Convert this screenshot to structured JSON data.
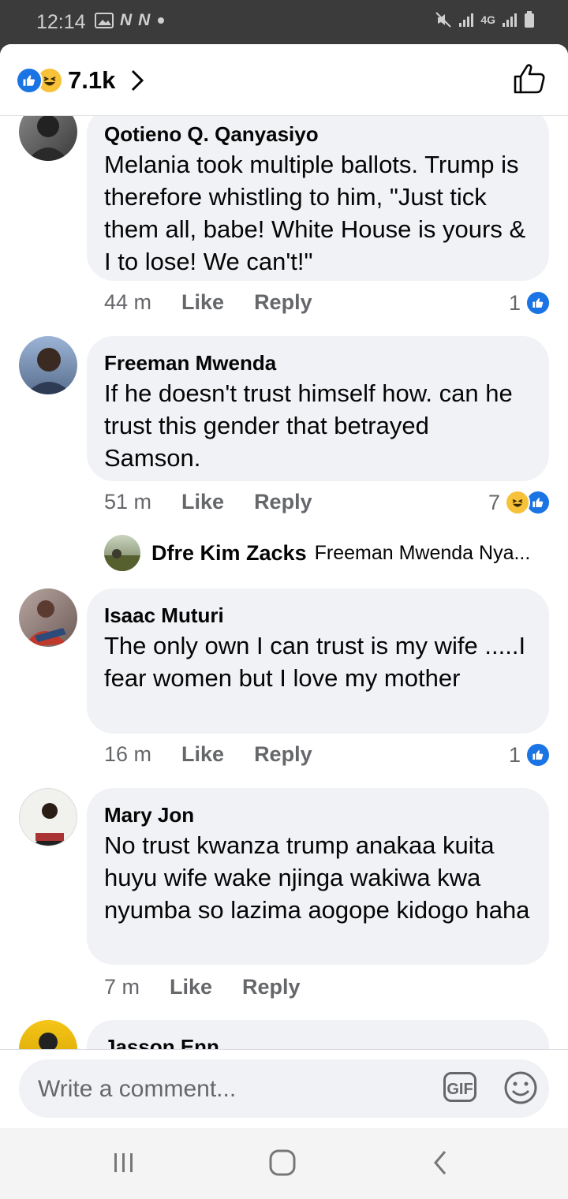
{
  "status_bar": {
    "time": "12:14",
    "icons": [
      "gallery-icon",
      "nn-icon",
      "nn-icon",
      "dot-icon",
      "mute-icon",
      "signal-icon",
      "4g-icon",
      "signal-icon",
      "battery-icon"
    ],
    "nn_label": "N",
    "lte_label": "4G"
  },
  "header": {
    "reaction_count": "7.1k",
    "reaction_icons": [
      "like-reaction-icon",
      "haha-reaction-icon"
    ]
  },
  "comments": [
    {
      "author": "Qotieno Q. Qanyasiyo",
      "text": "Melania took multiple ballots. Trump is therefore whistling to him, \"Just tick them all, babe! White House is yours & I to lose! We can't!\"",
      "time": "44 m",
      "like_label": "Like",
      "reply_label": "Reply",
      "reaction_count": "1",
      "reactions": [
        "like"
      ]
    },
    {
      "author": "Freeman Mwenda",
      "text": "If he doesn't trust himself how. can he trust this gender that betrayed Samson.",
      "time": "51 m",
      "like_label": "Like",
      "reply_label": "Reply",
      "reaction_count": "7",
      "reactions": [
        "haha",
        "like"
      ],
      "reply_preview": {
        "author": "Dfre Kim Zacks",
        "snippet": "Freeman Mwenda Nya..."
      }
    },
    {
      "author": "Isaac Muturi",
      "text": "The only own I can trust is my wife .....I fear women but I love my mother",
      "time": "16 m",
      "like_label": "Like",
      "reply_label": "Reply",
      "reaction_count": "1",
      "reactions": [
        "like"
      ]
    },
    {
      "author": "Mary Jon",
      "text": "No trust kwanza trump anakaa kuita huyu wife wake njinga wakiwa kwa nyumba so lazima aogope kidogo haha",
      "time": "7 m",
      "like_label": "Like",
      "reply_label": "Reply"
    },
    {
      "author": "Jasson Enn"
    }
  ],
  "composer": {
    "placeholder": "Write a comment...",
    "gif_label": "GIF"
  },
  "navbar": {
    "buttons": [
      "recent-apps",
      "home",
      "back"
    ]
  },
  "colors": {
    "brand_blue": "#1b74e4",
    "bubble_bg": "#f0f2f5",
    "secondary_text": "#65676b",
    "haha_yellow": "#f7c23a"
  }
}
